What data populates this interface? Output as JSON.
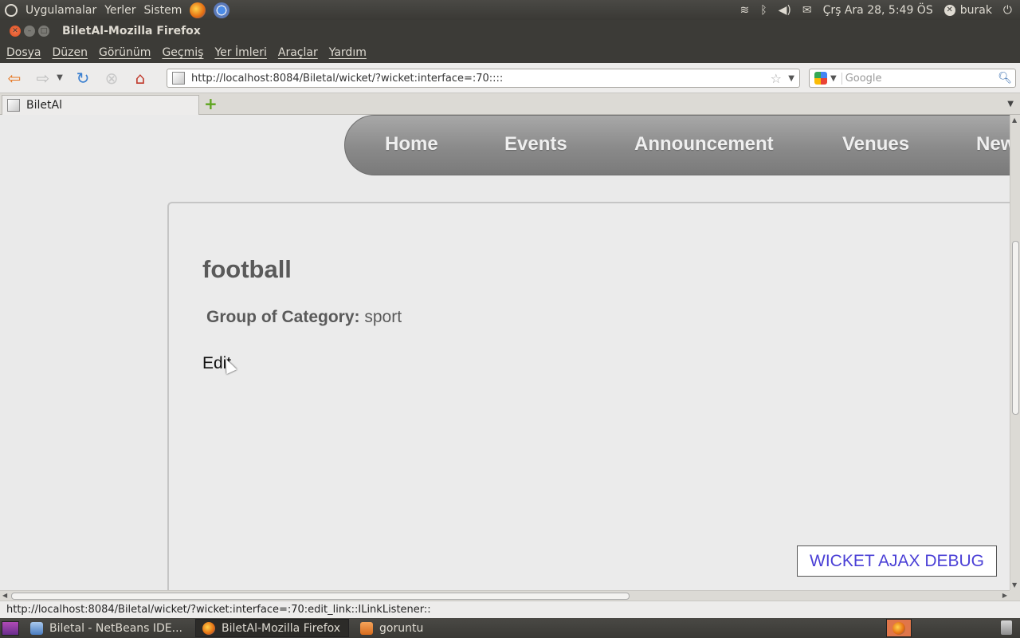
{
  "top_panel": {
    "menus": [
      "Uygulamalar",
      "Yerler",
      "Sistem"
    ],
    "datetime": "Çrş Ara 28,  5:49 ÖS",
    "user": "burak",
    "icons": [
      "wifi-icon",
      "bluetooth-icon",
      "volume-icon",
      "mail-icon",
      "power-icon"
    ]
  },
  "window": {
    "title": "BiletAl-Mozilla Firefox"
  },
  "menubar": {
    "items": [
      "Dosya",
      "Düzen",
      "Görünüm",
      "Geçmiş",
      "Yer İmleri",
      "Araçlar",
      "Yardım"
    ]
  },
  "navbar": {
    "url": "http://localhost:8084/Biletal/wicket/?wicket:interface=:70::::",
    "search_placeholder": "Google"
  },
  "tabs": [
    {
      "label": "BiletAl",
      "active": true
    }
  ],
  "page": {
    "nav": [
      "Home",
      "Events",
      "Announcement",
      "Venues",
      "New"
    ],
    "category_title": "football",
    "group_label": "Group of Category:",
    "group_value": "sport",
    "edit_link": "Edit",
    "debug_button": "WICKET AJAX DEBUG"
  },
  "statusbar": {
    "text": "http://localhost:8084/Biletal/wicket/?wicket:interface=:70:edit_link::ILinkListener::"
  },
  "taskbar": {
    "items": [
      {
        "label": "Biletal - NetBeans IDE...",
        "icon": "netbeans-icon",
        "active": false
      },
      {
        "label": "BiletAl-Mozilla Firefox",
        "icon": "firefox-icon",
        "active": true
      },
      {
        "label": "goruntu",
        "icon": "folder-icon",
        "active": false
      }
    ]
  }
}
